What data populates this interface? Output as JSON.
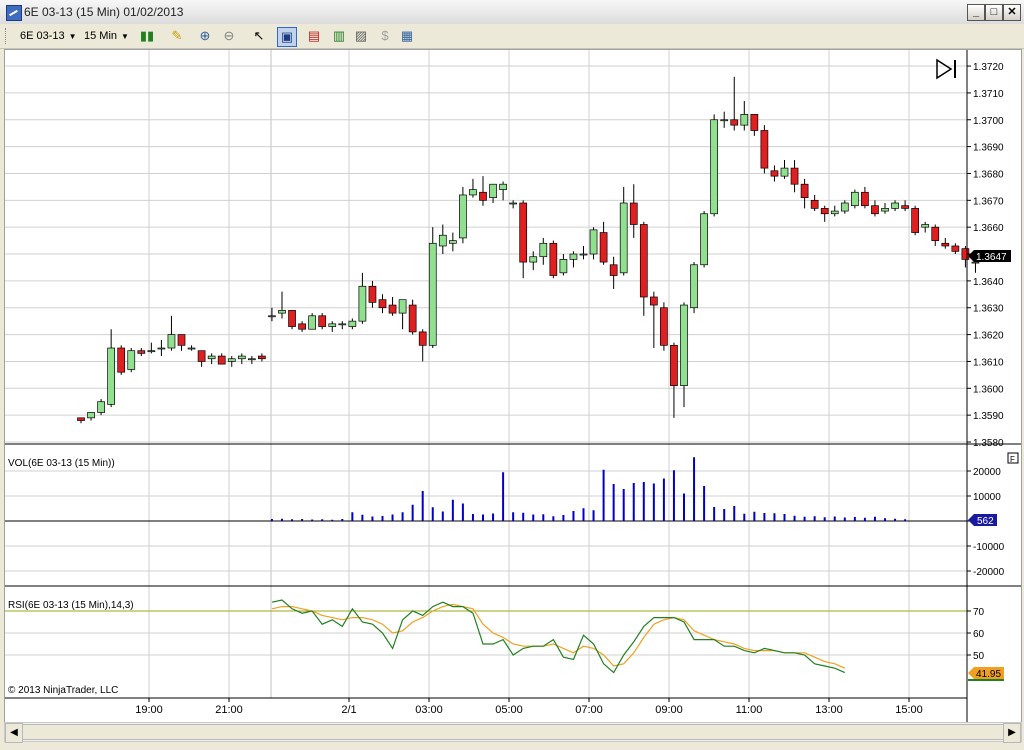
{
  "window": {
    "title": "6E 03-13 (15 Min)  01/02/2013",
    "minimize": "_",
    "maximize": "□",
    "close": "✕"
  },
  "toolbar": {
    "instrument": "6E 03-13",
    "interval": "15 Min",
    "icons": [
      "candlestick-style-icon",
      "drawing-pencil-icon",
      "zoom-in-icon",
      "zoom-out-icon",
      "cursor-select-icon",
      "data-box-icon",
      "strategies-icon",
      "indicators-icon",
      "chart-properties-icon",
      "chart-trader-icon",
      "properties-icon"
    ]
  },
  "price_panel": {
    "current_price": "1.3647",
    "scroll_end_icon": "scroll-to-end-icon",
    "price_ticks": [
      "1.3720",
      "1.3710",
      "1.3700",
      "1.3690",
      "1.3680",
      "1.3670",
      "1.3660",
      "1.3650",
      "1.3640",
      "1.3630",
      "1.3620",
      "1.3610",
      "1.3600",
      "1.3590",
      "1.3580"
    ]
  },
  "volume_panel": {
    "label": "VOL(6E 03-13 (15 Min))",
    "current_value": "562",
    "ticks": [
      "20000",
      "10000",
      "0",
      "-10000",
      "-20000"
    ],
    "f_box": "F"
  },
  "rsi_panel": {
    "label": "RSI(6E 03-13 (15 Min),14,3)",
    "current_value": "41.95",
    "ticks": [
      "70",
      "60",
      "50"
    ]
  },
  "copyright": "© 2013 NinjaTrader, LLC",
  "time_axis": [
    "19:00",
    "21:00",
    "2/1",
    "03:00",
    "05:00",
    "07:00",
    "09:00",
    "11:00",
    "13:00",
    "15:00"
  ],
  "colors": {
    "up": "#90e090",
    "down": "#e02020",
    "volume": "#0000cc",
    "rsi": "#208020",
    "rsi_avg": "#f0a020",
    "badge_price": "#000000",
    "badge_vol": "#0000aa",
    "badge_rsi": "#f0a020"
  },
  "chart_data": {
    "type": "candlestick",
    "ohlc": [
      [
        1.3589,
        1.3589,
        1.3587,
        1.3588
      ],
      [
        1.3589,
        1.3591,
        1.3588,
        1.3591
      ],
      [
        1.3591,
        1.3596,
        1.359,
        1.3595
      ],
      [
        1.3594,
        1.3622,
        1.3593,
        1.3615
      ],
      [
        1.3615,
        1.3616,
        1.3605,
        1.3606
      ],
      [
        1.3607,
        1.3615,
        1.3606,
        1.3614
      ],
      [
        1.3614,
        1.3615,
        1.3612,
        1.3613
      ],
      [
        1.3614,
        1.3617,
        1.3613,
        1.3614
      ],
      [
        1.3615,
        1.3618,
        1.3612,
        1.3615
      ],
      [
        1.3615,
        1.3627,
        1.3614,
        1.362
      ],
      [
        1.362,
        1.362,
        1.3614,
        1.3616
      ],
      [
        1.3615,
        1.3616,
        1.3614,
        1.3615
      ],
      [
        1.3614,
        1.3614,
        1.3608,
        1.361
      ],
      [
        1.3611,
        1.3613,
        1.3609,
        1.3612
      ],
      [
        1.3612,
        1.3613,
        1.3609,
        1.3609
      ],
      [
        1.361,
        1.3612,
        1.3608,
        1.3611
      ],
      [
        1.3611,
        1.3613,
        1.3609,
        1.3612
      ],
      [
        1.3611,
        1.3612,
        1.3609,
        1.3611
      ],
      [
        1.3612,
        1.3613,
        1.361,
        1.3611
      ],
      [
        1.3627,
        1.363,
        1.3625,
        1.3627
      ],
      [
        1.3628,
        1.3636,
        1.3626,
        1.3629
      ],
      [
        1.3629,
        1.3629,
        1.3622,
        1.3623
      ],
      [
        1.3624,
        1.3625,
        1.3621,
        1.3622
      ],
      [
        1.3622,
        1.3628,
        1.3622,
        1.3627
      ],
      [
        1.3627,
        1.3628,
        1.3622,
        1.3623
      ],
      [
        1.3623,
        1.3625,
        1.3621,
        1.3624
      ],
      [
        1.3624,
        1.3625,
        1.3622,
        1.3624
      ],
      [
        1.3623,
        1.3626,
        1.3622,
        1.3625
      ],
      [
        1.3625,
        1.3643,
        1.3624,
        1.3638
      ],
      [
        1.3638,
        1.364,
        1.363,
        1.3632
      ],
      [
        1.3633,
        1.3635,
        1.3628,
        1.363
      ],
      [
        1.3631,
        1.3634,
        1.3627,
        1.3628
      ],
      [
        1.3628,
        1.3632,
        1.3622,
        1.3633
      ],
      [
        1.3631,
        1.3633,
        1.362,
        1.3621
      ],
      [
        1.3621,
        1.3622,
        1.361,
        1.3616
      ],
      [
        1.3616,
        1.366,
        1.3615,
        1.3654
      ],
      [
        1.3653,
        1.3661,
        1.365,
        1.3657
      ],
      [
        1.3654,
        1.3658,
        1.3651,
        1.3655
      ],
      [
        1.3656,
        1.3675,
        1.3654,
        1.3672
      ],
      [
        1.3672,
        1.3678,
        1.3671,
        1.3674
      ],
      [
        1.3673,
        1.3679,
        1.3668,
        1.367
      ],
      [
        1.3671,
        1.3676,
        1.3669,
        1.3676
      ],
      [
        1.3674,
        1.3677,
        1.367,
        1.3676
      ],
      [
        1.3669,
        1.367,
        1.3667,
        1.3669
      ],
      [
        1.3669,
        1.367,
        1.3641,
        1.3647
      ],
      [
        1.3647,
        1.3651,
        1.3644,
        1.3649
      ],
      [
        1.3649,
        1.3656,
        1.3646,
        1.3654
      ],
      [
        1.3654,
        1.3655,
        1.3641,
        1.3642
      ],
      [
        1.3643,
        1.365,
        1.3642,
        1.3648
      ],
      [
        1.3648,
        1.3651,
        1.3645,
        1.365
      ],
      [
        1.365,
        1.3653,
        1.3648,
        1.365
      ],
      [
        1.365,
        1.366,
        1.3648,
        1.3659
      ],
      [
        1.3658,
        1.3662,
        1.3646,
        1.3647
      ],
      [
        1.3646,
        1.3649,
        1.3637,
        1.3642
      ],
      [
        1.3643,
        1.3675,
        1.3642,
        1.3669
      ],
      [
        1.3669,
        1.3676,
        1.3656,
        1.3661
      ],
      [
        1.3661,
        1.3662,
        1.3627,
        1.3634
      ],
      [
        1.3634,
        1.3636,
        1.3615,
        1.3631
      ],
      [
        1.363,
        1.3632,
        1.3614,
        1.3616
      ],
      [
        1.3616,
        1.3617,
        1.3589,
        1.3601
      ],
      [
        1.3601,
        1.3632,
        1.3593,
        1.3631
      ],
      [
        1.363,
        1.3647,
        1.3628,
        1.3646
      ],
      [
        1.3646,
        1.3666,
        1.3645,
        1.3665
      ],
      [
        1.3665,
        1.3702,
        1.3664,
        1.37
      ],
      [
        1.37,
        1.3703,
        1.3697,
        1.37
      ],
      [
        1.37,
        1.3716,
        1.3696,
        1.3698
      ],
      [
        1.3698,
        1.3707,
        1.3696,
        1.3702
      ],
      [
        1.3702,
        1.3702,
        1.3694,
        1.3696
      ],
      [
        1.3696,
        1.3698,
        1.368,
        1.3682
      ],
      [
        1.3681,
        1.3683,
        1.3677,
        1.3679
      ],
      [
        1.3679,
        1.3685,
        1.3678,
        1.3682
      ],
      [
        1.3682,
        1.3685,
        1.3673,
        1.3676
      ],
      [
        1.3676,
        1.3678,
        1.3667,
        1.3671
      ],
      [
        1.367,
        1.3672,
        1.3666,
        1.3667
      ],
      [
        1.3667,
        1.3668,
        1.3662,
        1.3665
      ],
      [
        1.3665,
        1.3668,
        1.3664,
        1.3666
      ],
      [
        1.3666,
        1.367,
        1.3665,
        1.3669
      ],
      [
        1.3668,
        1.3674,
        1.3667,
        1.3673
      ],
      [
        1.3673,
        1.3675,
        1.3667,
        1.3668
      ],
      [
        1.3668,
        1.367,
        1.3664,
        1.3665
      ],
      [
        1.3666,
        1.3669,
        1.3665,
        1.3667
      ],
      [
        1.3667,
        1.367,
        1.3666,
        1.3669
      ],
      [
        1.3668,
        1.367,
        1.3666,
        1.3667
      ],
      [
        1.3667,
        1.3668,
        1.3657,
        1.3658
      ],
      [
        1.366,
        1.3662,
        1.3658,
        1.3661
      ],
      [
        1.366,
        1.3661,
        1.3653,
        1.3655
      ],
      [
        1.3654,
        1.3656,
        1.3652,
        1.3653
      ],
      [
        1.3653,
        1.3654,
        1.365,
        1.3651
      ],
      [
        1.3652,
        1.3653,
        1.3645,
        1.3648
      ],
      [
        1.3647,
        1.3648,
        1.3643,
        1.3647
      ]
    ],
    "volume_start_index": 19,
    "volume": [
      800,
      900,
      700,
      800,
      600,
      700,
      500,
      800,
      3500,
      2500,
      1800,
      2000,
      2600,
      3500,
      6500,
      12000,
      5500,
      3800,
      8500,
      7000,
      2800,
      2600,
      3000,
      19500,
      3500,
      3300,
      2600,
      2700,
      1900,
      2400,
      4000,
      5100,
      4300,
      20500,
      14800,
      12800,
      15200,
      15600,
      15000,
      17000,
      20300,
      11000,
      25500,
      14000,
      5600,
      4800,
      6000,
      2900,
      3700,
      3200,
      3100,
      2800,
      2100,
      1700,
      1900,
      1500,
      1800,
      1400,
      1600,
      1300,
      1700,
      1100,
      900,
      700
    ],
    "rsi_start_index": 19,
    "rsi": [
      74,
      75,
      71,
      69,
      70,
      64,
      66,
      63,
      71,
      65,
      64,
      60,
      53,
      66,
      70,
      68,
      72,
      74,
      72,
      72,
      69,
      55,
      55,
      57,
      50,
      53,
      54,
      54,
      57,
      49,
      48,
      59,
      55,
      46,
      42,
      50,
      56,
      63,
      67,
      67,
      67,
      65,
      57,
      57,
      57,
      54,
      54,
      52,
      51,
      53,
      52,
      51,
      51,
      50,
      46,
      45,
      44,
      42
    ],
    "rsi_avg": [
      71,
      72,
      72,
      71,
      70,
      68,
      67,
      66,
      67,
      67,
      66,
      64,
      60,
      61,
      65,
      67,
      70,
      72,
      73,
      72,
      71,
      64,
      60,
      58,
      55,
      54,
      54,
      54,
      55,
      53,
      51,
      54,
      53,
      50,
      45,
      46,
      51,
      58,
      64,
      66,
      67,
      66,
      61,
      59,
      57,
      56,
      55,
      53,
      52,
      52,
      52,
      51,
      51,
      51,
      49,
      47,
      46,
      44
    ]
  }
}
